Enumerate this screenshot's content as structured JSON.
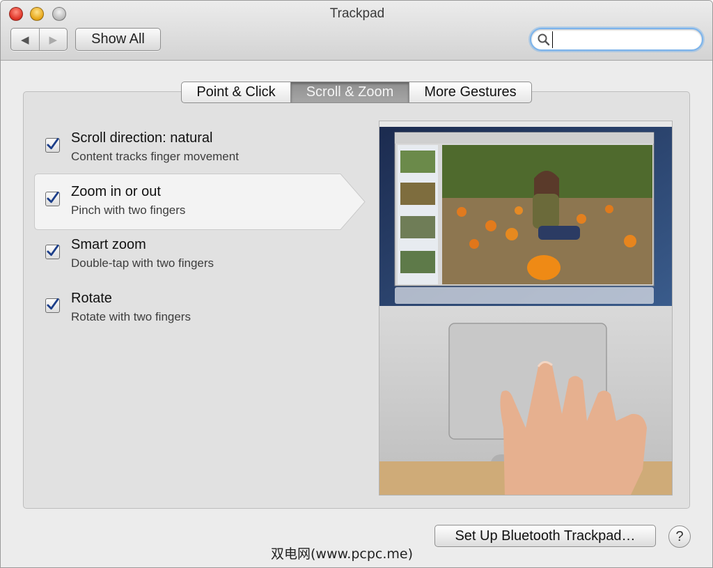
{
  "window": {
    "title": "Trackpad"
  },
  "toolbar": {
    "back_label": "◀",
    "forward_label": "▶",
    "show_all_label": "Show All"
  },
  "search": {
    "value": "",
    "placeholder": ""
  },
  "tabs": [
    {
      "label": "Point & Click"
    },
    {
      "label": "Scroll & Zoom"
    },
    {
      "label": "More Gestures"
    }
  ],
  "gestures": [
    {
      "title": "Scroll direction: natural",
      "description": "Content tracks finger movement",
      "checked": true
    },
    {
      "title": "Zoom in or out",
      "description": "Pinch with two fingers",
      "checked": true,
      "selected": true
    },
    {
      "title": "Smart zoom",
      "description": "Double-tap with two fingers",
      "checked": true
    },
    {
      "title": "Rotate",
      "description": "Rotate with two fingers",
      "checked": true
    }
  ],
  "footer": {
    "bluetooth_button_label": "Set Up Bluetooth Trackpad…",
    "help_label": "?"
  },
  "watermark": {
    "text": "双电网(www.pcpc.me)"
  },
  "colors": {
    "checkbox_check": "#1d3f8a",
    "tab_selected": "#9a9a9a",
    "search_focus": "#7ab3ec"
  }
}
